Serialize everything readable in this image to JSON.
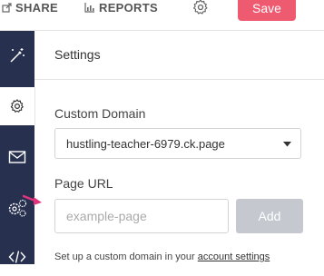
{
  "topbar": {
    "share_label": "SHARE",
    "reports_label": "REPORTS",
    "save_label": "Save"
  },
  "sidebar": {
    "items": [
      {
        "icon": "magic-wand-icon"
      },
      {
        "icon": "gear-icon",
        "active": true
      },
      {
        "icon": "envelope-icon"
      },
      {
        "icon": "multi-gear-icon"
      },
      {
        "icon": "code-icon"
      }
    ]
  },
  "settings": {
    "title": "Settings",
    "custom_domain_label": "Custom Domain",
    "custom_domain_value": "hustling-teacher-6979.ck.page",
    "page_url_label": "Page URL",
    "page_url_placeholder": "example-page",
    "add_label": "Add",
    "help_text": "Set up a custom domain in your ",
    "help_link": "account settings"
  },
  "colors": {
    "sidebar_bg": "#27314f",
    "save_button": "#ee5a6f",
    "add_button_disabled": "#c5c9cf",
    "arrow": "#e0357d"
  }
}
